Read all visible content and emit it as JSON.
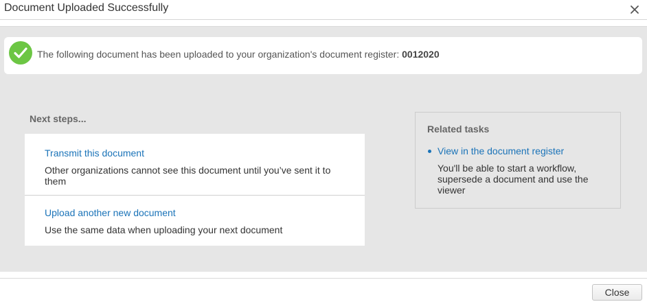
{
  "dialog": {
    "title": "Document Uploaded Successfully",
    "close_icon": "close-x-icon"
  },
  "success": {
    "icon": "check-circle-icon",
    "icon_color": "#6cc644",
    "message": "The following document has been uploaded to your organization's document register: ",
    "document_number": "0012020"
  },
  "next_steps": {
    "title": "Next steps...",
    "items": [
      {
        "link": "Transmit this document",
        "description": "Other organizations cannot see this document until you’ve sent it to them"
      },
      {
        "link": "Upload another new document",
        "description": "Use the same data when uploading your next document"
      }
    ]
  },
  "related_tasks": {
    "title": "Related tasks",
    "items": [
      {
        "link": "View in the document register",
        "description": "You'll be able to start a workflow, supersede a document and use the viewer"
      }
    ]
  },
  "footer": {
    "close_label": "Close"
  },
  "colors": {
    "link": "#1a73b8",
    "body_background": "#e6e6e6"
  }
}
